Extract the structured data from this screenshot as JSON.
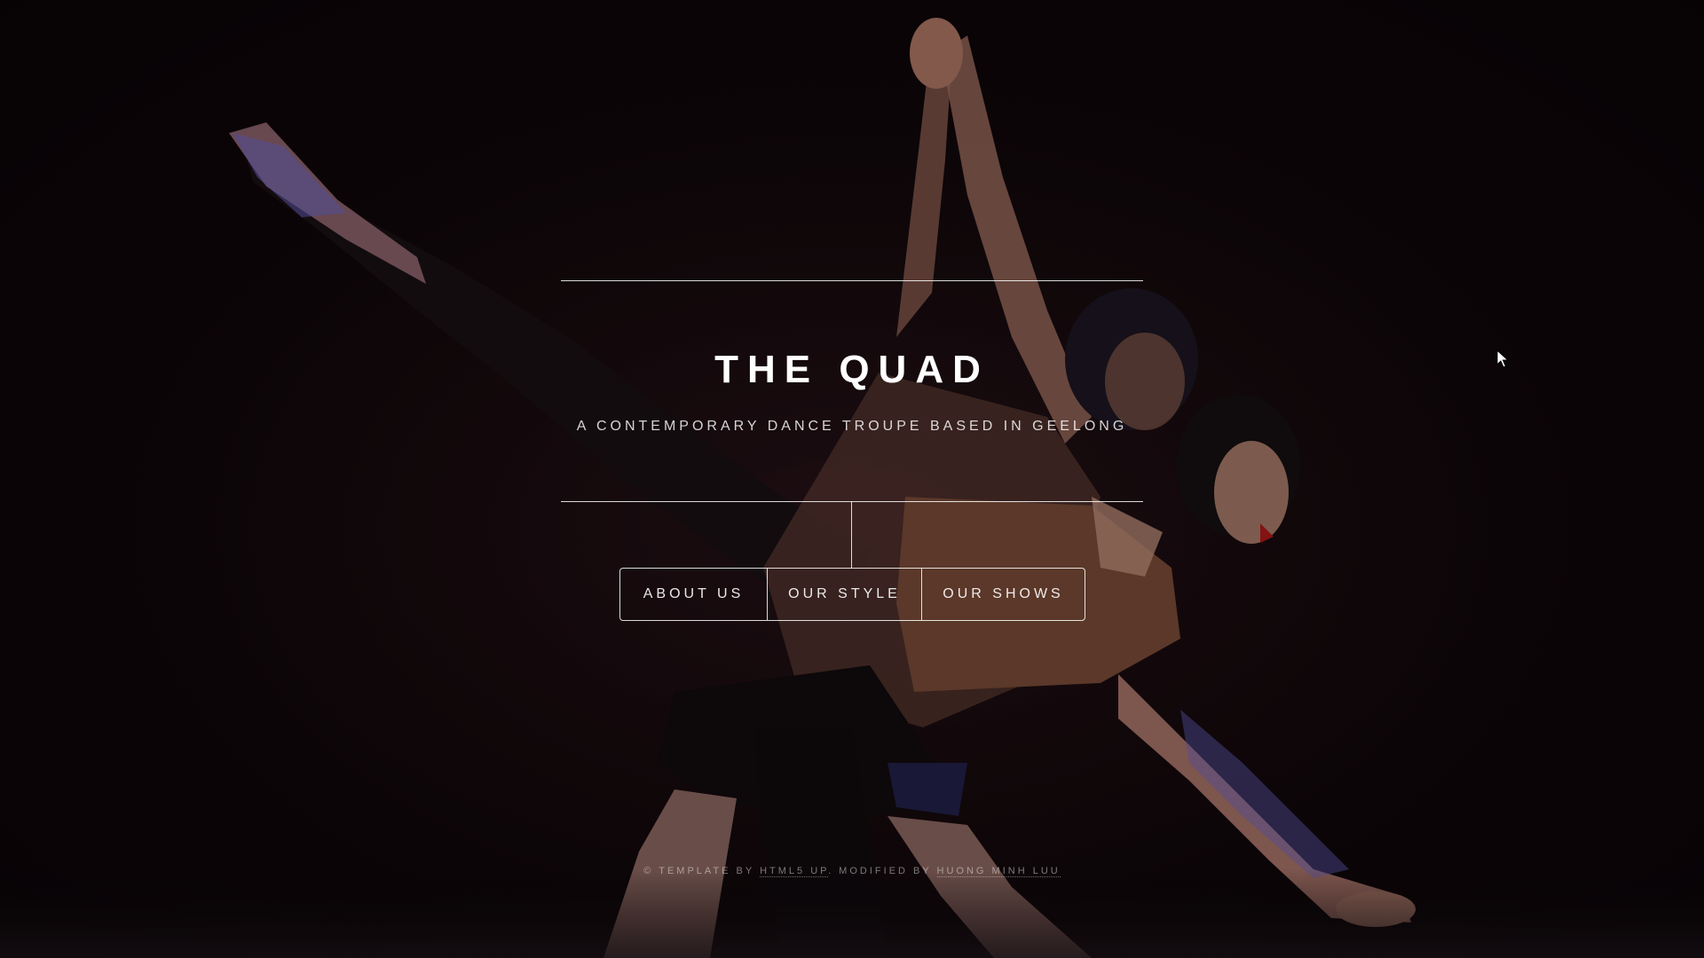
{
  "header": {
    "title": "THE QUAD",
    "tagline": "A CONTEMPORARY DANCE TROUPE BASED IN GEELONG"
  },
  "nav": {
    "items": [
      {
        "label": "ABOUT US"
      },
      {
        "label": "OUR STYLE"
      },
      {
        "label": "OUR SHOWS"
      }
    ]
  },
  "footer": {
    "prefix": "© TEMPLATE BY ",
    "template_link": "HTML5 UP",
    "middle": ". MODIFIED BY ",
    "author_link": "HUONG MINH LUU"
  },
  "background": {
    "image_subject": "two-dancers-photo",
    "colors": {
      "base": "#0a0507",
      "skin": "#b07a60",
      "leotard": "#7a4a33",
      "stage_light": "#5a6ad8"
    }
  },
  "icons": {
    "cursor": "mouse-pointer-icon"
  }
}
